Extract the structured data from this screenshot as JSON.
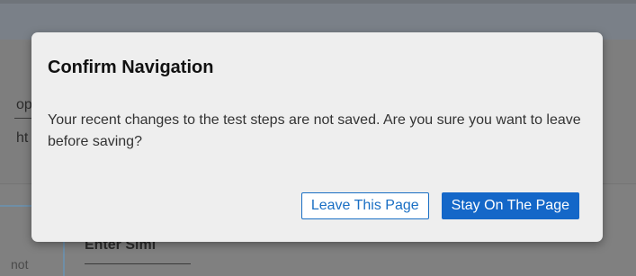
{
  "background": {
    "field_label_partial": "op",
    "field_value_partial": "ht",
    "enter_field_partial": "Enter Siml",
    "left_text_partial": "not"
  },
  "dialog": {
    "title": "Confirm Navigation",
    "message": "Your recent changes to the test steps are not saved. Are you sure you want to leave before saving?",
    "leave_button": "Leave This Page",
    "stay_button": "Stay On The Page"
  },
  "colors": {
    "primary": "#1467c8",
    "overlay": "#808080",
    "dialog_bg": "#eeeeee"
  }
}
